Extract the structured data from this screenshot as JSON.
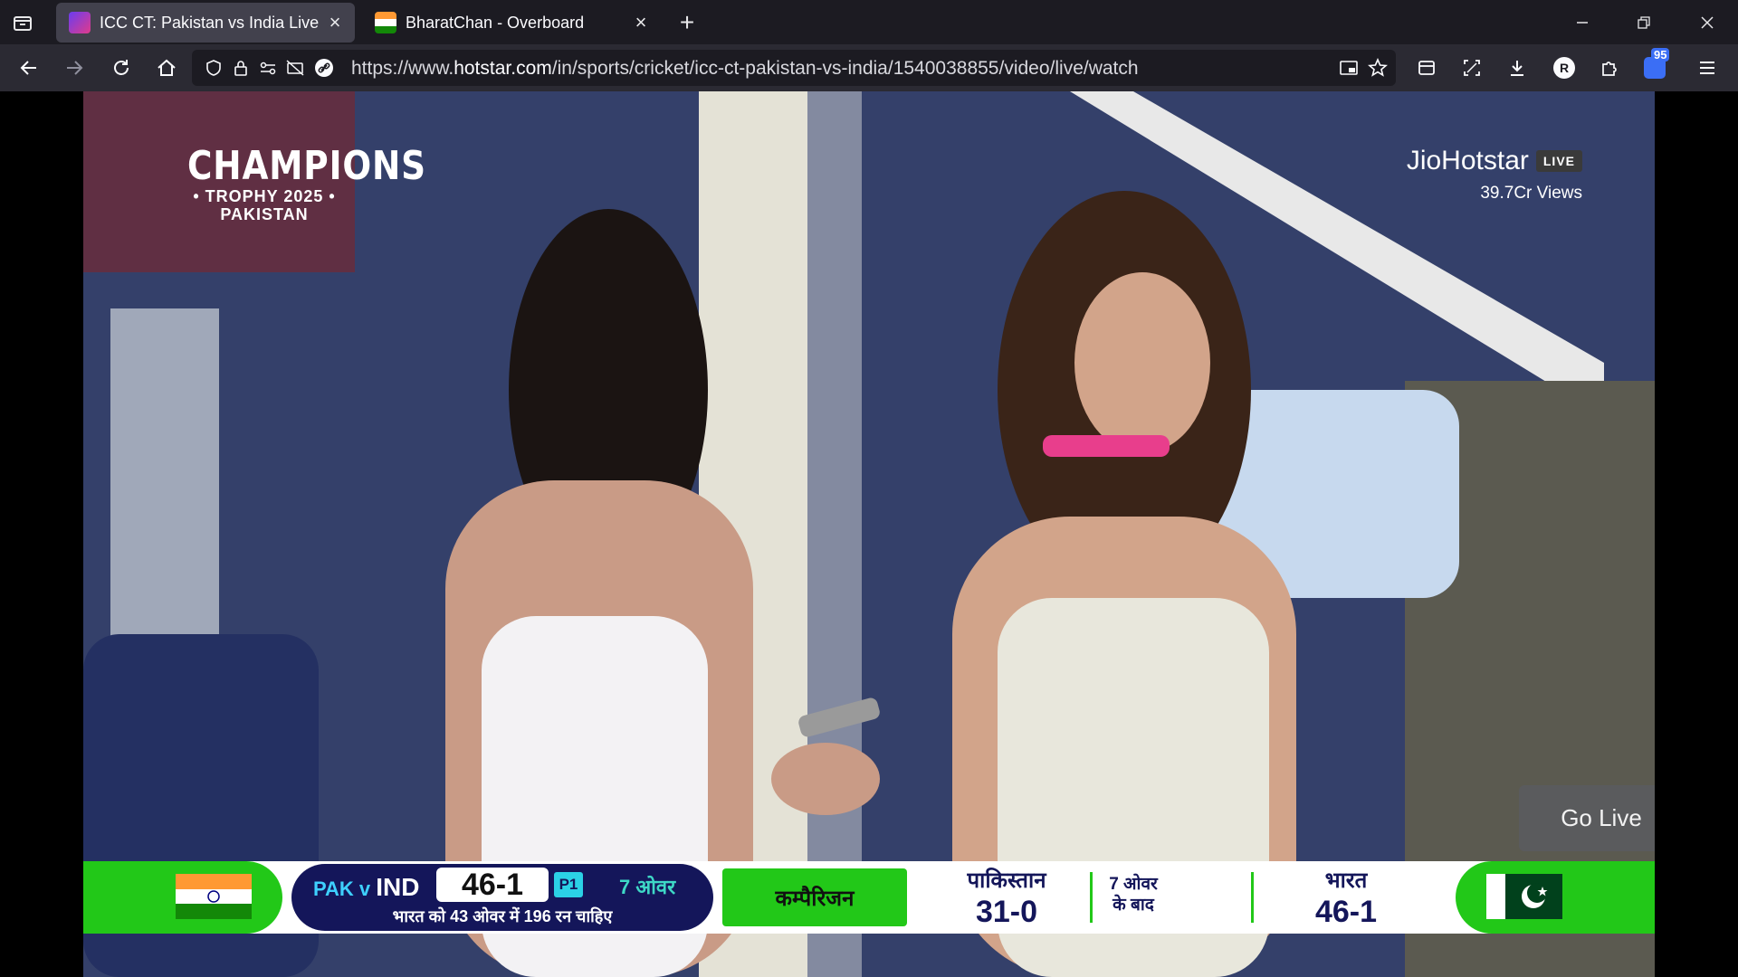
{
  "browser": {
    "tabs": [
      {
        "title": "ICC CT: Pakistan vs India Live v",
        "active": true
      },
      {
        "title": "BharatChan - Overboard",
        "active": false
      }
    ],
    "new_tab_symbol": "+",
    "url_prefix": "https://www.",
    "url_host": "hotstar.com",
    "url_path": "/in/sports/cricket/icc-ct-pakistan-vs-india/1540038855/video/live/watch",
    "extension_badge": "95",
    "profile_initial": "R"
  },
  "player": {
    "tournament_logo": {
      "line1": "CHAMPIONS",
      "line2": "• TROPHY 2025 •",
      "line3": "PAKISTAN"
    },
    "brand_name": "JioHotstar",
    "live_badge": "LIVE",
    "views": "39.7Cr Views",
    "go_live_label": "Go Live"
  },
  "scoreboard": {
    "match_prefix": "PAK v ",
    "match_batting": "IND",
    "score": "46-1",
    "phase": "P1",
    "overs": "7 ओवर",
    "target_text": "भारत को 43 ओवर में 196 रन चाहिए",
    "compare_label": "कम्पैरिजन",
    "team1_label": "पाकिस्तान",
    "team1_score": "31-0",
    "after_overs_line1": "7 ओवर",
    "after_overs_line2": "के बाद",
    "team2_label": "भारत",
    "team2_score": "46-1"
  },
  "colors": {
    "scoreboard_green": "#22c818",
    "scoreboard_navy": "#14165a",
    "browser_toolbar": "#2b2a33",
    "tab_strip": "#1c1b22"
  }
}
